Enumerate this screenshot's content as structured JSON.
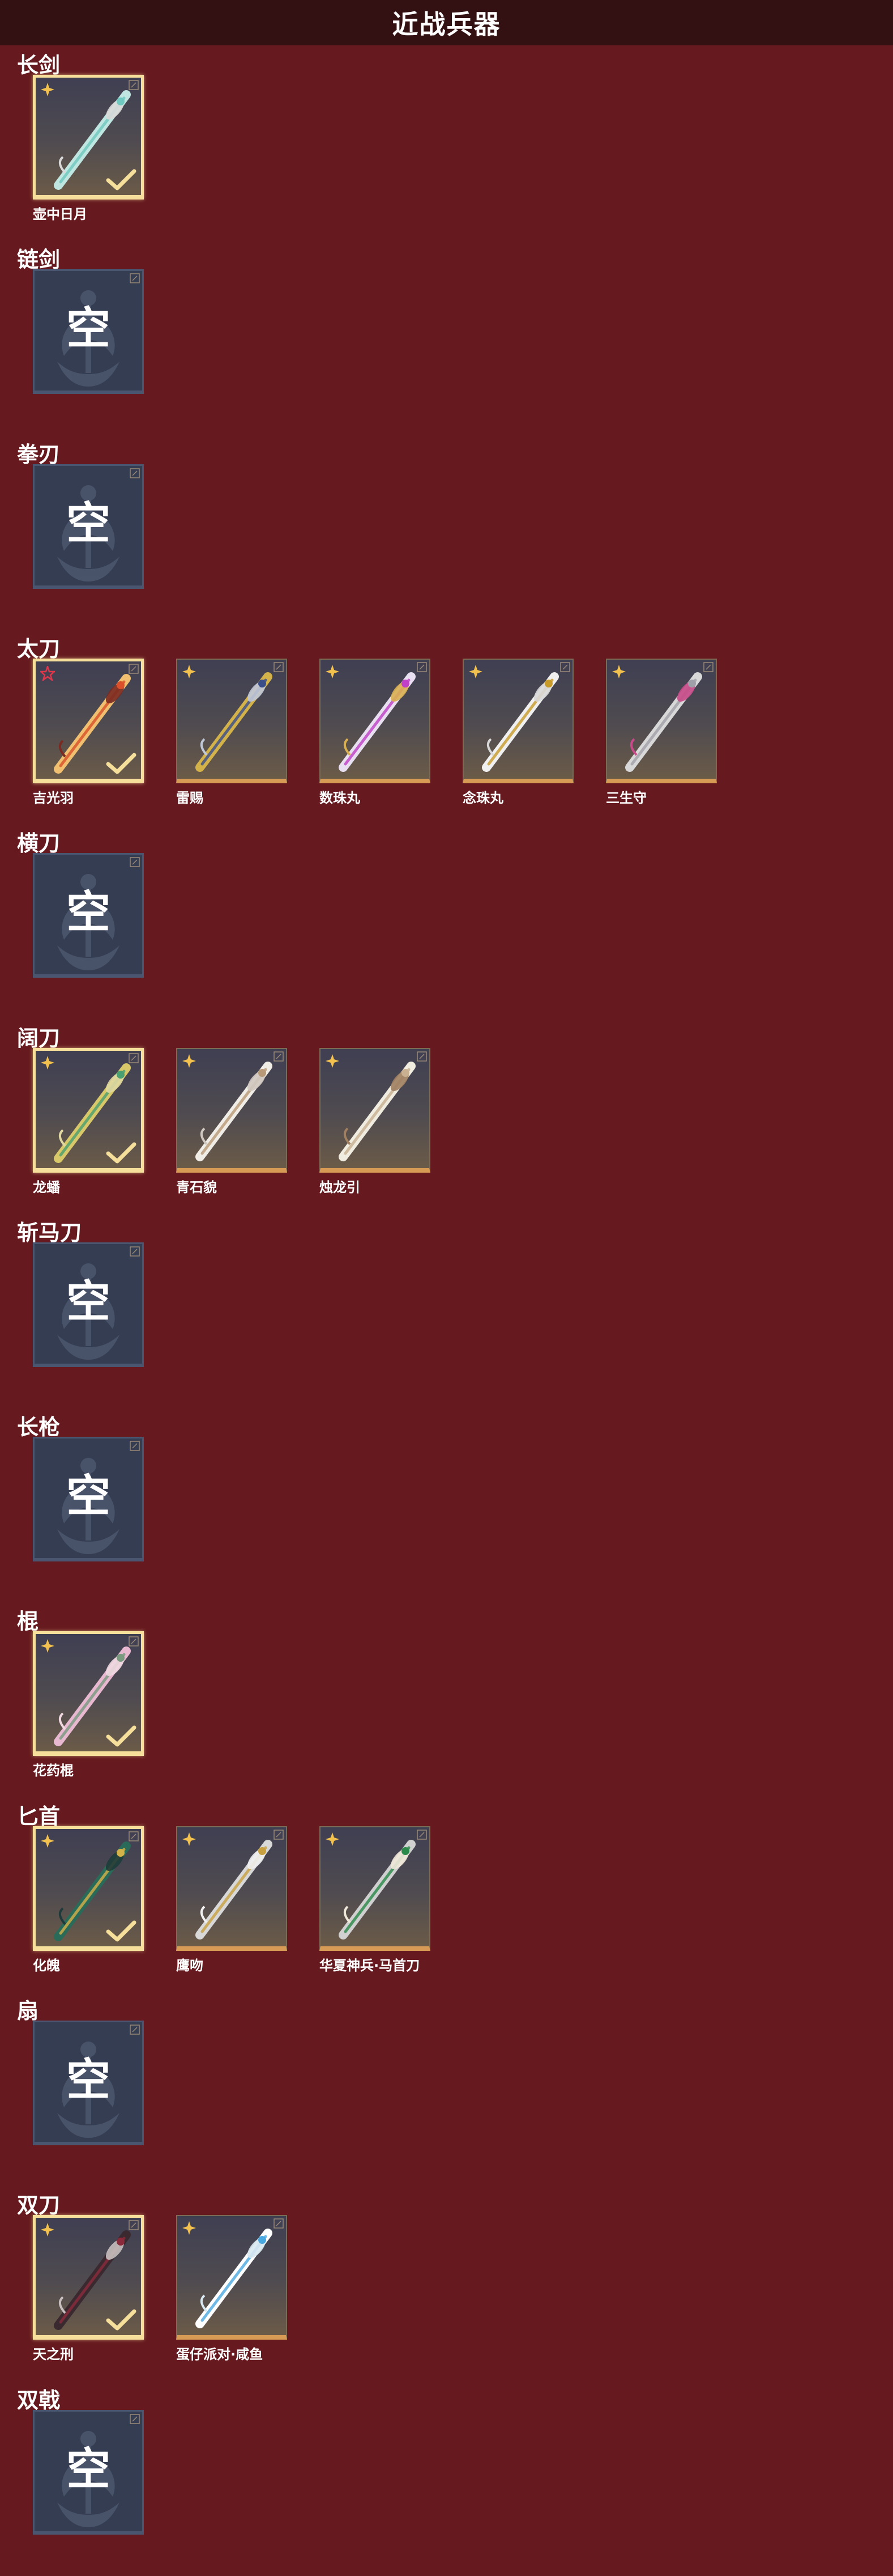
{
  "header": {
    "title": "近战兵器"
  },
  "empty_label": "空",
  "colors": {
    "background": "#661a1f",
    "header_bg": "#331012",
    "card_frame_gold": "#d89b55",
    "equipped_frame": "#f6df9a",
    "empty_card_bg": "#343d52",
    "rarity_gold_star": "#f2c14e",
    "rarity_red_star": "#e0374a"
  },
  "categories": [
    {
      "name": "长剑",
      "items": [
        {
          "name": "壶中日月",
          "equipped": true,
          "rarity": "gold",
          "icon": "long-sword-jade-icon"
        }
      ]
    },
    {
      "name": "链剑",
      "items": []
    },
    {
      "name": "拳刃",
      "items": []
    },
    {
      "name": "太刀",
      "items": [
        {
          "name": "吉光羽",
          "equipped": true,
          "rarity": "red",
          "icon": "flame-katana-icon"
        },
        {
          "name": "雷赐",
          "equipped": false,
          "rarity": "gold",
          "icon": "lightning-katana-icon"
        },
        {
          "name": "数珠丸",
          "equipped": false,
          "rarity": "gold",
          "icon": "purple-katana-icon"
        },
        {
          "name": "念珠丸",
          "equipped": false,
          "rarity": "gold",
          "icon": "gold-katana-icon"
        },
        {
          "name": "三生守",
          "equipped": false,
          "rarity": "gold",
          "icon": "silver-katana-icon"
        }
      ]
    },
    {
      "name": "横刀",
      "items": []
    },
    {
      "name": "阔刀",
      "items": [
        {
          "name": "龙蟠",
          "equipped": true,
          "rarity": "gold",
          "icon": "dragon-broadblade-icon"
        },
        {
          "name": "青石貌",
          "equipped": false,
          "rarity": "gold",
          "icon": "white-broadblade-icon"
        },
        {
          "name": "烛龙引",
          "equipped": false,
          "rarity": "gold",
          "icon": "candle-dragon-broadblade-icon"
        }
      ]
    },
    {
      "name": "斩马刀",
      "items": []
    },
    {
      "name": "长枪",
      "items": []
    },
    {
      "name": "棍",
      "items": [
        {
          "name": "花药棍",
          "equipped": true,
          "rarity": "gold",
          "icon": "flower-staff-icon"
        }
      ]
    },
    {
      "name": "匕首",
      "items": [
        {
          "name": "化魄",
          "equipped": true,
          "rarity": "gold",
          "icon": "jade-dagger-icon"
        },
        {
          "name": "鹰吻",
          "equipped": false,
          "rarity": "gold",
          "icon": "curved-dagger-icon"
        },
        {
          "name": "华夏神兵·马首刀",
          "equipped": false,
          "rarity": "gold",
          "icon": "horse-head-knife-icon"
        }
      ]
    },
    {
      "name": "扇",
      "items": []
    },
    {
      "name": "双刀",
      "items": [
        {
          "name": "天之刑",
          "equipped": true,
          "rarity": "gold",
          "icon": "dark-twin-blades-icon"
        },
        {
          "name": "蛋仔派对·咸鱼",
          "equipped": false,
          "rarity": "gold",
          "icon": "salted-fish-twin-blades-icon"
        }
      ]
    },
    {
      "name": "双戟",
      "items": []
    }
  ]
}
